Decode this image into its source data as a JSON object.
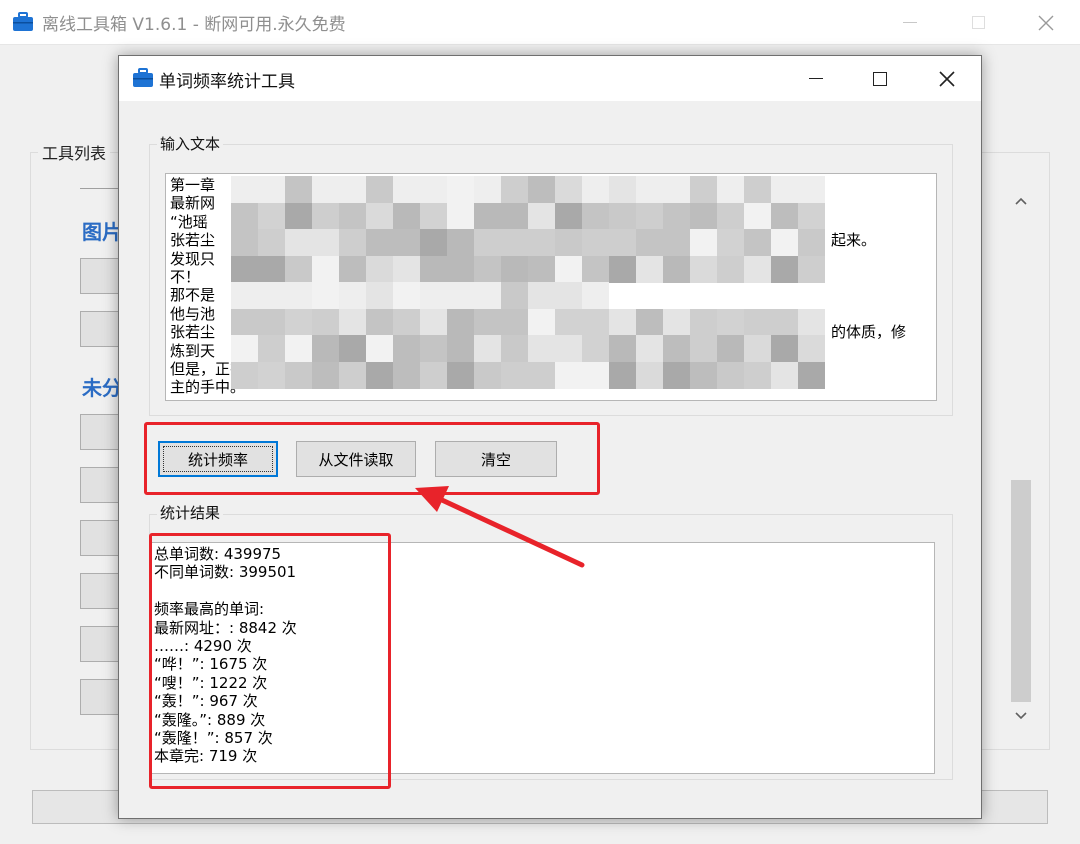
{
  "main_window": {
    "title": "离线工具箱 V1.6.1 - 断网可用.永久免费",
    "tool_list_label": "工具列表",
    "category_1": "图片",
    "category_2": "未分"
  },
  "dialog": {
    "title": "单词频率统计工具",
    "input_group_label": "输入文本",
    "input_text_lines": [
      "第一章",
      "最新网",
      "“池瑶",
      "张若尘",
      "发现只",
      "不！",
      "那不是",
      "他与池",
      "张若尘",
      "炼到天",
      "但是，正在他成为昆仑界年轻一代第一人的时候，却死在自己青梅竹马的未婚妻池瑶公",
      "主的手中。"
    ],
    "input_text_fragments": [
      {
        "text": "起来。"
      },
      {
        "text": "的体质，修"
      }
    ],
    "buttons": {
      "count": "统计频率",
      "read_file": "从文件读取",
      "clear": "清空"
    },
    "result_group_label": "统计结果",
    "result_lines": [
      "总单词数: 439975",
      "不同单词数: 399501",
      "",
      "频率最高的单词:",
      "最新网址：: 8842 次",
      "……: 4290 次",
      "“哗！”: 1675 次",
      "“嗖！”: 1222 次",
      "“轰！”: 967 次",
      "“轰隆。”: 889 次",
      "“轰隆！”: 857 次",
      "本章完: 719 次"
    ]
  },
  "colors": {
    "highlight_red": "#e8232a",
    "heading_blue": "#2b6cc4",
    "focus_blue": "#0078d7",
    "window_bg": "#f0f0f0"
  },
  "icons": {
    "app": "toolbox-icon",
    "close": "close-icon",
    "maximize": "maximize-icon",
    "minimize": "minimize-icon"
  }
}
